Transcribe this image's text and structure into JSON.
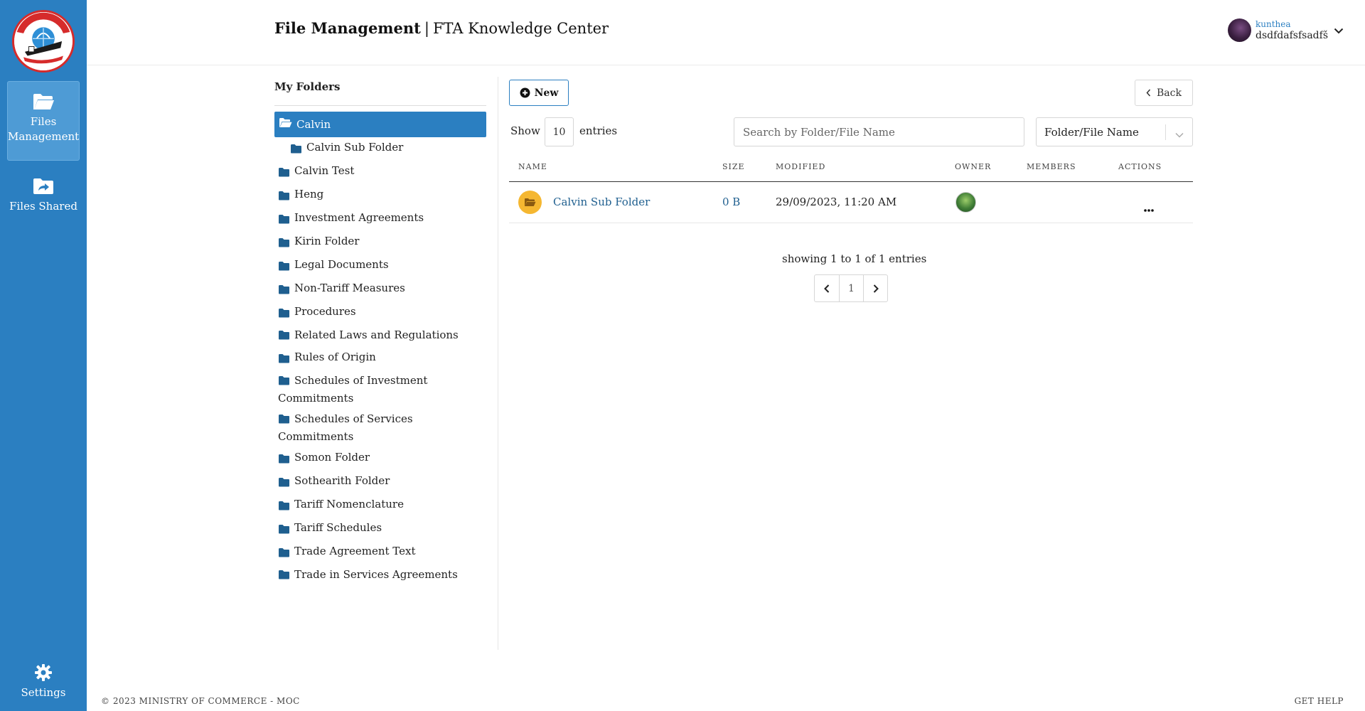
{
  "sidebar": {
    "nav": [
      {
        "label": "Files Management",
        "icon": "folder-open-icon"
      },
      {
        "label": "Files Shared",
        "icon": "folder-share-icon"
      }
    ],
    "settings_label": "Settings"
  },
  "header": {
    "title_bold": "File Management",
    "separator": "|",
    "title_rest": "FTA Knowledge Center",
    "user": {
      "role": "kunthea",
      "name": "dsdfdafsfsadfš"
    }
  },
  "tree": {
    "title": "My Folders",
    "folders": [
      {
        "label": "Calvin",
        "selected": true,
        "open": true
      },
      {
        "label": "Calvin Sub Folder",
        "child": true
      },
      {
        "label": "Calvin Test"
      },
      {
        "label": "Heng"
      },
      {
        "label": "Investment Agreements"
      },
      {
        "label": "Kirin Folder"
      },
      {
        "label": "Legal Documents"
      },
      {
        "label": "Non-Tariff Measures"
      },
      {
        "label": "Procedures"
      },
      {
        "label": "Related Laws and Regulations"
      },
      {
        "label": "Rules of Origin"
      },
      {
        "label": "Schedules of Investment Commitments"
      },
      {
        "label": "Schedules of Services Commitments"
      },
      {
        "label": "Somon Folder"
      },
      {
        "label": "Sothearith Folder"
      },
      {
        "label": "Tariff Nomenclature"
      },
      {
        "label": "Tariff Schedules"
      },
      {
        "label": "Trade Agreement Text"
      },
      {
        "label": "Trade in Services Agreements"
      }
    ]
  },
  "toolbar": {
    "new_label": "New",
    "back_label": "Back",
    "show_label": "Show",
    "entries_value": "10",
    "entries_label": "entries",
    "search_placeholder": "Search by Folder/File Name",
    "filter_value": "Folder/File Name"
  },
  "table": {
    "headers": [
      "NAME",
      "SIZE",
      "MODIFIED",
      "OWNER",
      "MEMBERS",
      "ACTIONS"
    ],
    "rows": [
      {
        "name": "Calvin Sub Folder",
        "size": "0 B",
        "modified": "29/09/2023, 11:20 AM",
        "members": ""
      }
    ]
  },
  "pagination": {
    "summary": "showing 1 to 1 of 1 entries",
    "current_page": "1"
  },
  "footer": {
    "copyright": "© 2023 MINISTRY OF COMMERCE - MOC",
    "help": "GET HELP"
  },
  "colors": {
    "sidebar": "#2b7fc1",
    "accent": "#2b7fc1",
    "folder": "#1f5f8f",
    "folder_badge": "#f5b731"
  }
}
